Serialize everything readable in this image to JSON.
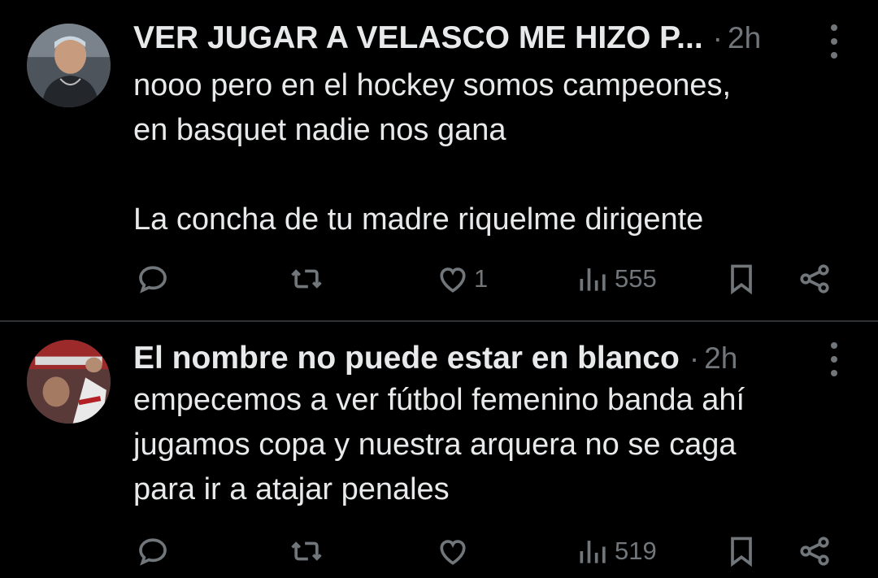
{
  "tweets": [
    {
      "author_name": "VER JUGAR A VELASCO ME HIZO P...",
      "separator": "·",
      "time": "2h",
      "text_lines": [
        "nooo pero en el hockey somos campeones,",
        "en basquet nadie nos gana",
        "",
        "La concha de tu madre riquelme dirigente"
      ],
      "replies": "",
      "retweets": "",
      "likes": "1",
      "views": "555"
    },
    {
      "author_name": "El nombre no puede estar en blanco",
      "separator": "·",
      "time": "2h",
      "text_lines": [
        "empecemos a ver fútbol femenino banda ahí",
        "jugamos copa y nuestra arquera no se caga",
        "para ir a atajar penales"
      ],
      "replies": "",
      "retweets": "",
      "likes": "",
      "views": "519"
    }
  ],
  "icons": {
    "reply": "reply-icon",
    "retweet": "retweet-icon",
    "like": "heart-icon",
    "views": "views-icon",
    "bookmark": "bookmark-icon",
    "share": "share-icon",
    "more": "more-vertical-icon"
  },
  "colors": {
    "background": "#000000",
    "text": "#e7e9ea",
    "muted": "#71767b",
    "divider": "#2f3336"
  }
}
